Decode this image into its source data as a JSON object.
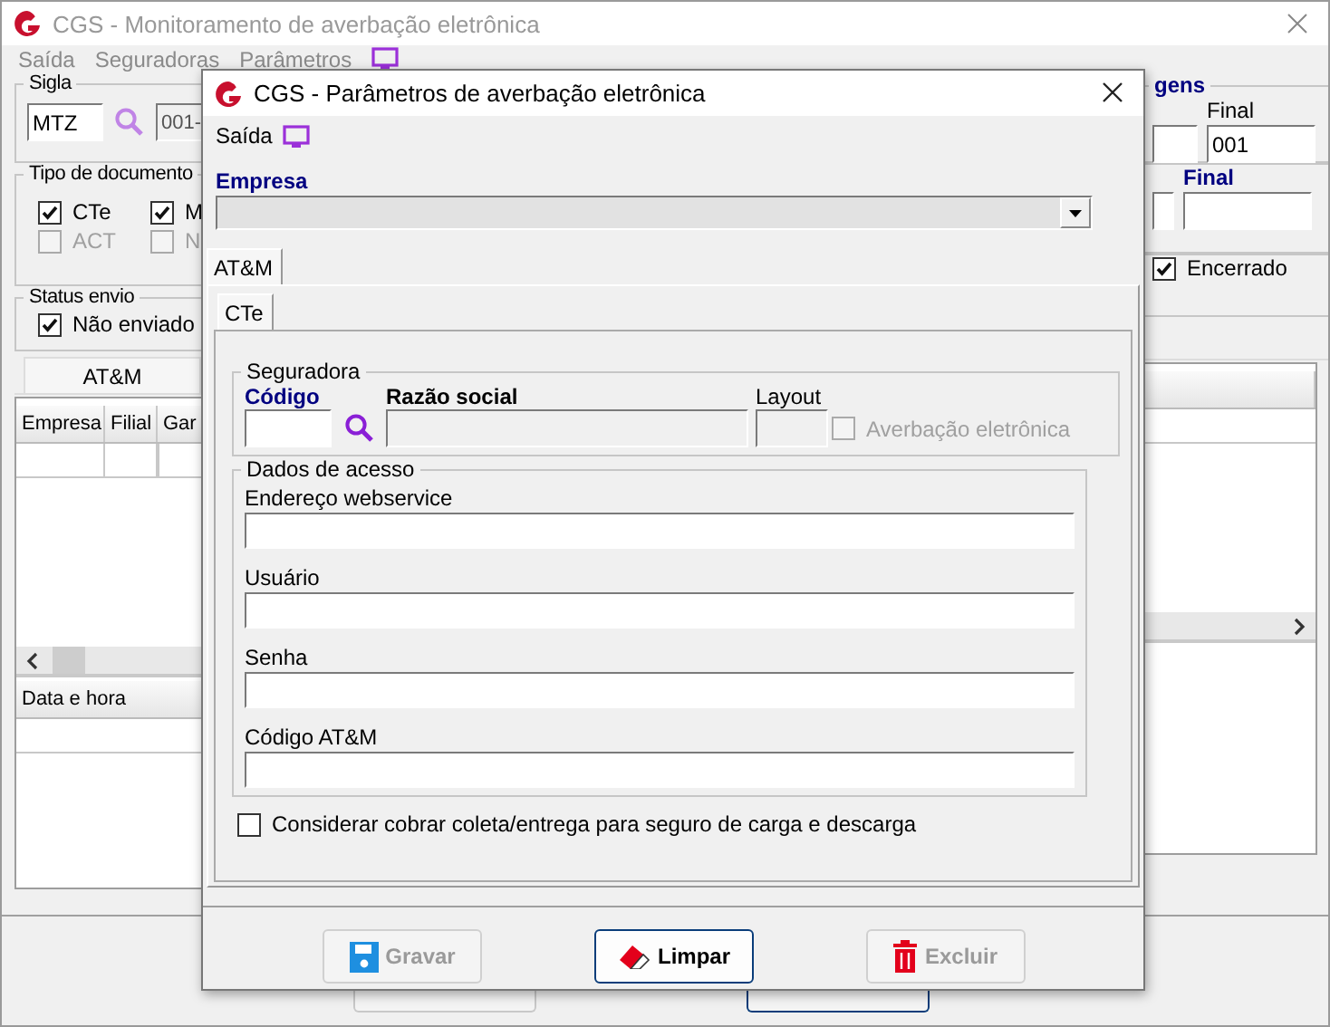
{
  "window": {
    "title": "CGS - Monitoramento de averbação eletrônica"
  },
  "menu": [
    {
      "label": "Saída"
    },
    {
      "label": "Seguradoras"
    },
    {
      "label": "Parâmetros"
    }
  ],
  "left_panel": {
    "sigla": {
      "legend": "Sigla",
      "value": "MTZ",
      "branch_value": "001-"
    },
    "tipo_documento": {
      "legend": "Tipo de documento",
      "options": [
        {
          "label": "CTe",
          "checked": true,
          "disabled": false
        },
        {
          "label": "M",
          "checked": true,
          "disabled": false
        },
        {
          "label": "ACT",
          "checked": false,
          "disabled": true
        },
        {
          "label": "N",
          "checked": false,
          "disabled": true
        }
      ]
    },
    "status_envio": {
      "legend": "Status envio",
      "options": [
        {
          "label": "Não enviado",
          "checked": true
        }
      ]
    }
  },
  "right_panel": {
    "group_1": {
      "legend": "gens",
      "label": "Final",
      "value": "001"
    },
    "group_2": {
      "label": "Final"
    },
    "status_option": {
      "label": "Encerrado",
      "checked": true
    }
  },
  "tabs": [
    {
      "label": "AT&M",
      "selected": true
    }
  ],
  "table": {
    "columns": [
      "Empresa",
      "Filial",
      "Gar"
    ]
  },
  "log_table": {
    "columns": [
      "Data e hora"
    ]
  },
  "dialog": {
    "title": "CGS - Parâmetros de averbação eletrônica",
    "menu": [
      {
        "label": "Saída"
      }
    ],
    "empresa": {
      "label": "Empresa",
      "disabled": true
    },
    "tabs": [
      {
        "label": "AT&M",
        "selected": true
      }
    ],
    "subtabs": [
      {
        "label": "CTe",
        "selected": true
      }
    ],
    "seguradora": {
      "legend": "Seguradora",
      "codigo_label": "Código",
      "razao_label": "Razão social",
      "layout_label": "Layout",
      "averbacao": {
        "label": "Averbação eletrônica",
        "checked": false,
        "disabled": true
      }
    },
    "dados_acesso": {
      "legend": "Dados de acesso",
      "fields": [
        {
          "label": "Endereço webservice"
        },
        {
          "label": "Usuário"
        },
        {
          "label": "Senha"
        },
        {
          "label": "Código AT&M"
        }
      ]
    },
    "considerar": {
      "label": "Considerar cobrar coleta/entrega para seguro de carga e descarga",
      "checked": false
    },
    "buttons": [
      {
        "label": "Gravar",
        "kind": "save",
        "disabled": true
      },
      {
        "label": "Limpar",
        "kind": "clear",
        "disabled": false
      },
      {
        "label": "Excluir",
        "kind": "delete",
        "disabled": true
      }
    ]
  }
}
